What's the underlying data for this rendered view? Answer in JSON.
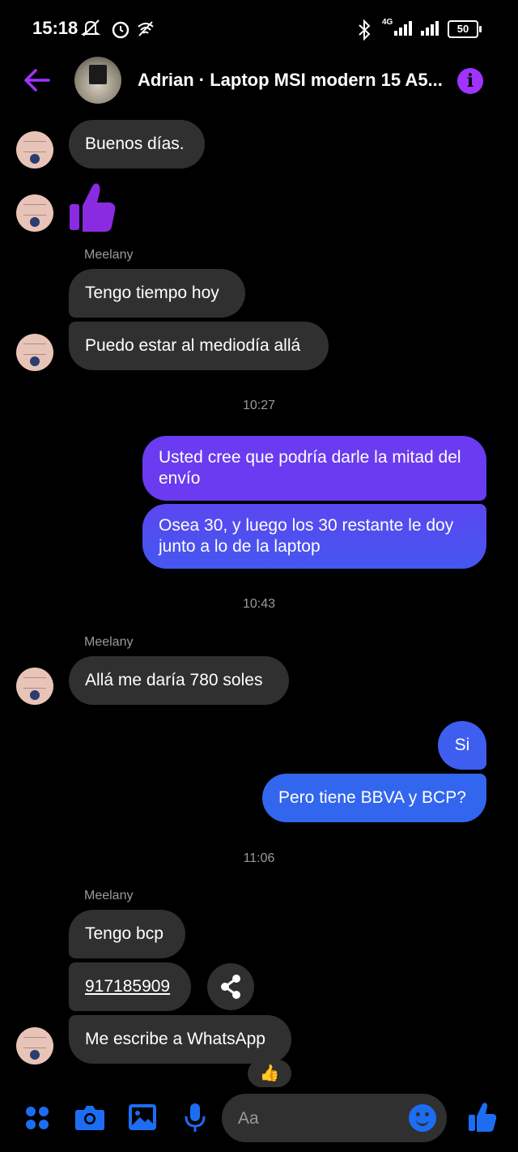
{
  "status_bar": {
    "time": "15:18",
    "network": "4G",
    "battery": "50"
  },
  "header": {
    "title": "Adrian · Laptop MSI modern 15 A5...",
    "back": "←",
    "info": "i"
  },
  "messages": {
    "m1": "Buenos días.",
    "m2_emoji": "👍",
    "sender1": "Meelany",
    "m3": "Tengo tiempo hoy",
    "m4": "Puedo estar al mediodía allá",
    "time1": "10:27",
    "m5": "Usted cree que podría darle la mitad del envío",
    "m6": "Osea 30, y luego los 30 restante le doy junto a lo de la laptop",
    "time2": "10:43",
    "sender2": "Meelany",
    "m7": "Allá me daría 780 soles",
    "m8": "Si",
    "m9": "Pero tiene BBVA y BCP?",
    "time3": "11:06",
    "sender3": "Meelany",
    "m10": "Tengo bcp",
    "m11": "917185909",
    "m12": "Me escribe a WhatsApp",
    "reaction": "👍"
  },
  "composer": {
    "placeholder": "Aa"
  },
  "colors": {
    "accent": "#a033ff",
    "incoming": "#303030",
    "outgoing_top": "#7b33ee",
    "outgoing_bottom": "#3b6af0",
    "icon_blue": "#1c6df2"
  },
  "icons": [
    "back-arrow-icon",
    "info-icon",
    "share-icon",
    "apps-icon",
    "camera-icon",
    "gallery-icon",
    "microphone-icon",
    "emoji-icon",
    "thumbs-up-icon"
  ]
}
